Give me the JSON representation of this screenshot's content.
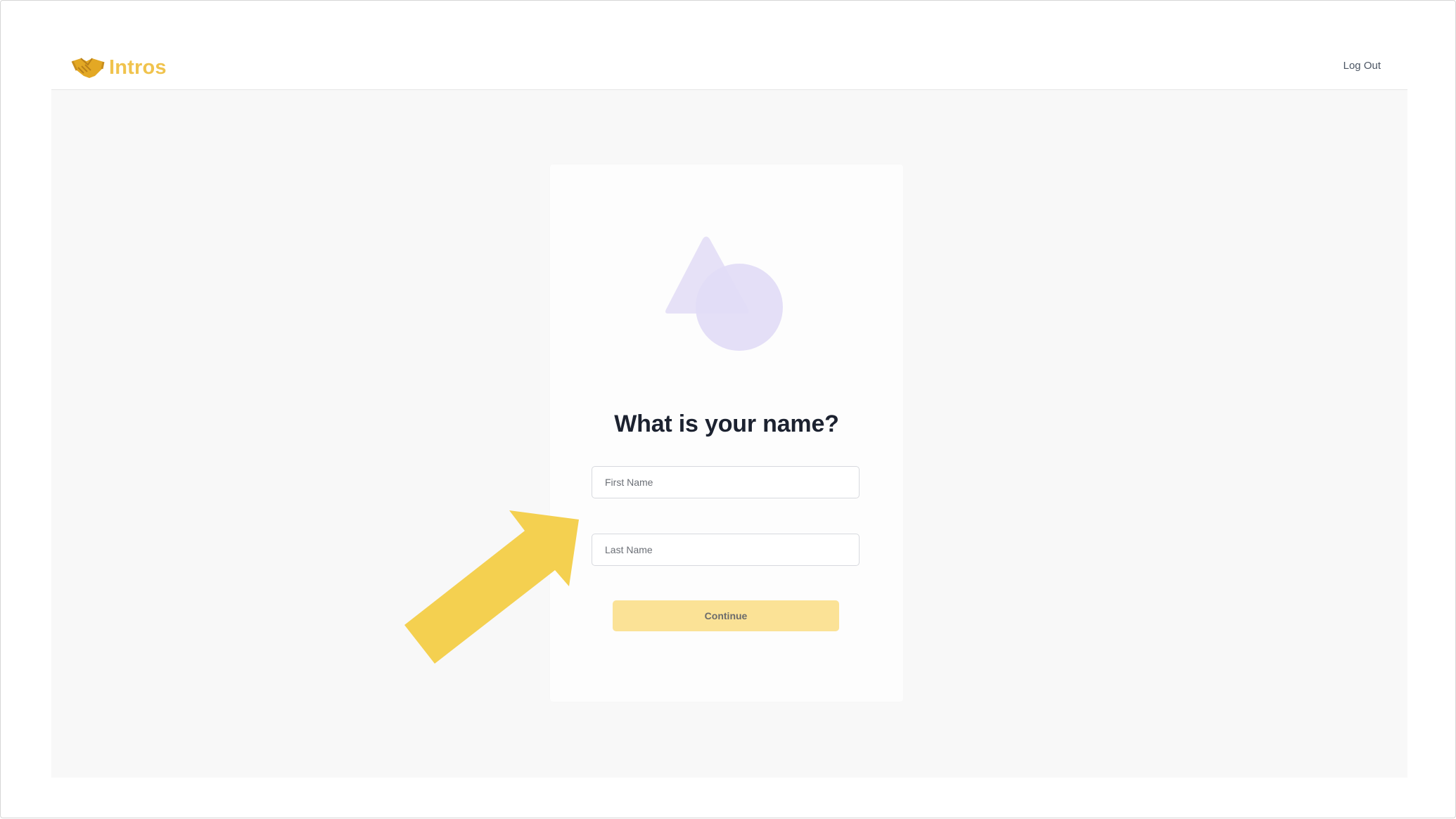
{
  "header": {
    "brand_name": "Intros",
    "brand_icon": "handshake-icon",
    "logout_label": "Log Out"
  },
  "onboarding": {
    "illustration_icon": "shapes-illustration",
    "title": "What is your name?",
    "first_name": {
      "value": "",
      "placeholder": "First Name"
    },
    "last_name": {
      "value": "",
      "placeholder": "Last Name"
    },
    "continue_label": "Continue"
  },
  "annotation": {
    "arrow_icon": "pointer-arrow",
    "color": "#f4d050"
  },
  "colors": {
    "brand": "#f0c34d",
    "button_disabled": "#fbe296",
    "illustration": "#e6e1f7",
    "background": "#f8f8f8"
  }
}
